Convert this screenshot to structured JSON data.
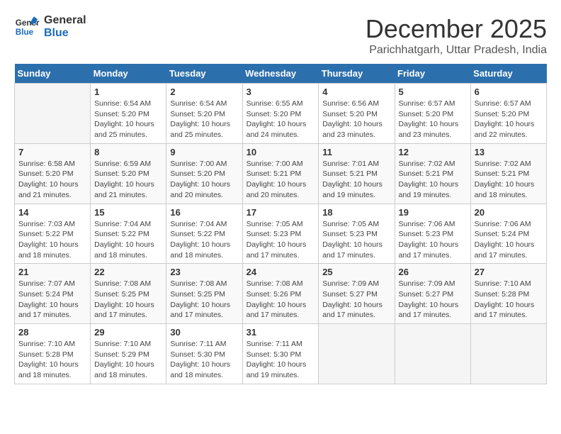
{
  "logo": {
    "line1": "General",
    "line2": "Blue"
  },
  "title": "December 2025",
  "location": "Parichhatgarh, Uttar Pradesh, India",
  "days_header": [
    "Sunday",
    "Monday",
    "Tuesday",
    "Wednesday",
    "Thursday",
    "Friday",
    "Saturday"
  ],
  "weeks": [
    [
      {
        "day": "",
        "info": ""
      },
      {
        "day": "1",
        "info": "Sunrise: 6:54 AM\nSunset: 5:20 PM\nDaylight: 10 hours\nand 25 minutes."
      },
      {
        "day": "2",
        "info": "Sunrise: 6:54 AM\nSunset: 5:20 PM\nDaylight: 10 hours\nand 25 minutes."
      },
      {
        "day": "3",
        "info": "Sunrise: 6:55 AM\nSunset: 5:20 PM\nDaylight: 10 hours\nand 24 minutes."
      },
      {
        "day": "4",
        "info": "Sunrise: 6:56 AM\nSunset: 5:20 PM\nDaylight: 10 hours\nand 23 minutes."
      },
      {
        "day": "5",
        "info": "Sunrise: 6:57 AM\nSunset: 5:20 PM\nDaylight: 10 hours\nand 23 minutes."
      },
      {
        "day": "6",
        "info": "Sunrise: 6:57 AM\nSunset: 5:20 PM\nDaylight: 10 hours\nand 22 minutes."
      }
    ],
    [
      {
        "day": "7",
        "info": "Sunrise: 6:58 AM\nSunset: 5:20 PM\nDaylight: 10 hours\nand 21 minutes."
      },
      {
        "day": "8",
        "info": "Sunrise: 6:59 AM\nSunset: 5:20 PM\nDaylight: 10 hours\nand 21 minutes."
      },
      {
        "day": "9",
        "info": "Sunrise: 7:00 AM\nSunset: 5:20 PM\nDaylight: 10 hours\nand 20 minutes."
      },
      {
        "day": "10",
        "info": "Sunrise: 7:00 AM\nSunset: 5:21 PM\nDaylight: 10 hours\nand 20 minutes."
      },
      {
        "day": "11",
        "info": "Sunrise: 7:01 AM\nSunset: 5:21 PM\nDaylight: 10 hours\nand 19 minutes."
      },
      {
        "day": "12",
        "info": "Sunrise: 7:02 AM\nSunset: 5:21 PM\nDaylight: 10 hours\nand 19 minutes."
      },
      {
        "day": "13",
        "info": "Sunrise: 7:02 AM\nSunset: 5:21 PM\nDaylight: 10 hours\nand 18 minutes."
      }
    ],
    [
      {
        "day": "14",
        "info": "Sunrise: 7:03 AM\nSunset: 5:22 PM\nDaylight: 10 hours\nand 18 minutes."
      },
      {
        "day": "15",
        "info": "Sunrise: 7:04 AM\nSunset: 5:22 PM\nDaylight: 10 hours\nand 18 minutes."
      },
      {
        "day": "16",
        "info": "Sunrise: 7:04 AM\nSunset: 5:22 PM\nDaylight: 10 hours\nand 18 minutes."
      },
      {
        "day": "17",
        "info": "Sunrise: 7:05 AM\nSunset: 5:23 PM\nDaylight: 10 hours\nand 17 minutes."
      },
      {
        "day": "18",
        "info": "Sunrise: 7:05 AM\nSunset: 5:23 PM\nDaylight: 10 hours\nand 17 minutes."
      },
      {
        "day": "19",
        "info": "Sunrise: 7:06 AM\nSunset: 5:23 PM\nDaylight: 10 hours\nand 17 minutes."
      },
      {
        "day": "20",
        "info": "Sunrise: 7:06 AM\nSunset: 5:24 PM\nDaylight: 10 hours\nand 17 minutes."
      }
    ],
    [
      {
        "day": "21",
        "info": "Sunrise: 7:07 AM\nSunset: 5:24 PM\nDaylight: 10 hours\nand 17 minutes."
      },
      {
        "day": "22",
        "info": "Sunrise: 7:08 AM\nSunset: 5:25 PM\nDaylight: 10 hours\nand 17 minutes."
      },
      {
        "day": "23",
        "info": "Sunrise: 7:08 AM\nSunset: 5:25 PM\nDaylight: 10 hours\nand 17 minutes."
      },
      {
        "day": "24",
        "info": "Sunrise: 7:08 AM\nSunset: 5:26 PM\nDaylight: 10 hours\nand 17 minutes."
      },
      {
        "day": "25",
        "info": "Sunrise: 7:09 AM\nSunset: 5:27 PM\nDaylight: 10 hours\nand 17 minutes."
      },
      {
        "day": "26",
        "info": "Sunrise: 7:09 AM\nSunset: 5:27 PM\nDaylight: 10 hours\nand 17 minutes."
      },
      {
        "day": "27",
        "info": "Sunrise: 7:10 AM\nSunset: 5:28 PM\nDaylight: 10 hours\nand 17 minutes."
      }
    ],
    [
      {
        "day": "28",
        "info": "Sunrise: 7:10 AM\nSunset: 5:28 PM\nDaylight: 10 hours\nand 18 minutes."
      },
      {
        "day": "29",
        "info": "Sunrise: 7:10 AM\nSunset: 5:29 PM\nDaylight: 10 hours\nand 18 minutes."
      },
      {
        "day": "30",
        "info": "Sunrise: 7:11 AM\nSunset: 5:30 PM\nDaylight: 10 hours\nand 18 minutes."
      },
      {
        "day": "31",
        "info": "Sunrise: 7:11 AM\nSunset: 5:30 PM\nDaylight: 10 hours\nand 19 minutes."
      },
      {
        "day": "",
        "info": ""
      },
      {
        "day": "",
        "info": ""
      },
      {
        "day": "",
        "info": ""
      }
    ]
  ]
}
